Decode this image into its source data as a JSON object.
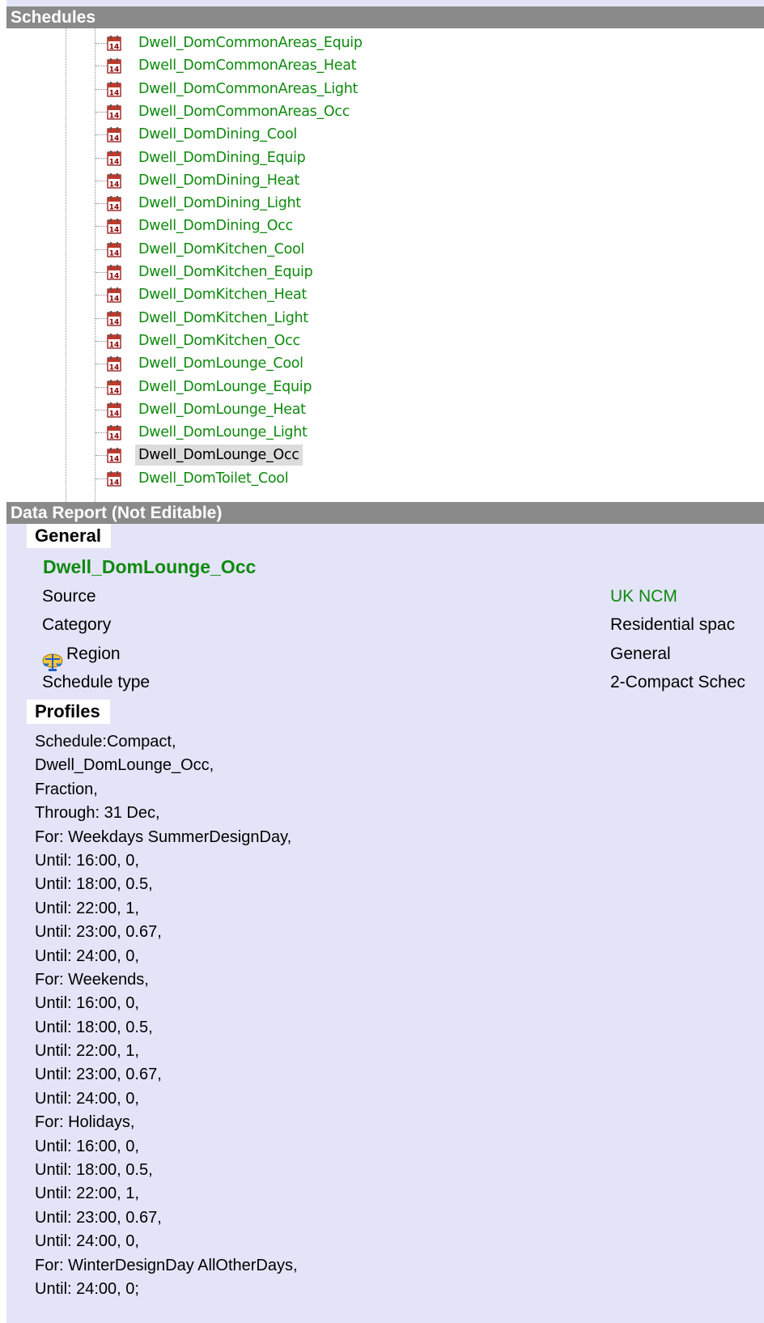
{
  "schedules_panel": {
    "title": "Schedules",
    "items": [
      {
        "label": "Dwell_DomCommonAreas_Equip",
        "selected": false
      },
      {
        "label": "Dwell_DomCommonAreas_Heat",
        "selected": false
      },
      {
        "label": "Dwell_DomCommonAreas_Light",
        "selected": false
      },
      {
        "label": "Dwell_DomCommonAreas_Occ",
        "selected": false
      },
      {
        "label": "Dwell_DomDining_Cool",
        "selected": false
      },
      {
        "label": "Dwell_DomDining_Equip",
        "selected": false
      },
      {
        "label": "Dwell_DomDining_Heat",
        "selected": false
      },
      {
        "label": "Dwell_DomDining_Light",
        "selected": false
      },
      {
        "label": "Dwell_DomDining_Occ",
        "selected": false
      },
      {
        "label": "Dwell_DomKitchen_Cool",
        "selected": false
      },
      {
        "label": "Dwell_DomKitchen_Equip",
        "selected": false
      },
      {
        "label": "Dwell_DomKitchen_Heat",
        "selected": false
      },
      {
        "label": "Dwell_DomKitchen_Light",
        "selected": false
      },
      {
        "label": "Dwell_DomKitchen_Occ",
        "selected": false
      },
      {
        "label": "Dwell_DomLounge_Cool",
        "selected": false
      },
      {
        "label": "Dwell_DomLounge_Equip",
        "selected": false
      },
      {
        "label": "Dwell_DomLounge_Heat",
        "selected": false
      },
      {
        "label": "Dwell_DomLounge_Light",
        "selected": false
      },
      {
        "label": "Dwell_DomLounge_Occ",
        "selected": true
      },
      {
        "label": "Dwell_DomToilet_Cool",
        "selected": false
      }
    ],
    "item_icon": "calendar-14-icon"
  },
  "report_panel": {
    "title": "Data Report (Not Editable)",
    "general": {
      "heading": "General",
      "name": "Dwell_DomLounge_Occ",
      "source_label": "Source",
      "source_value": "UK NCM",
      "category_label": "Category",
      "category_value": "Residential spac",
      "region_label": "Region",
      "region_value": "General",
      "region_icon": "region-scale-icon",
      "type_label": "Schedule type",
      "type_value": "2-Compact Schec"
    },
    "profiles": {
      "heading": "Profiles",
      "lines": [
        "Schedule:Compact,",
        "Dwell_DomLounge_Occ,",
        "Fraction,",
        "Through: 31 Dec,",
        "For: Weekdays SummerDesignDay,",
        "Until: 16:00, 0,",
        "Until: 18:00, 0.5,",
        "Until: 22:00, 1,",
        "Until: 23:00, 0.67,",
        "Until: 24:00, 0,",
        "For: Weekends,",
        "Until: 16:00, 0,",
        "Until: 18:00, 0.5,",
        "Until: 22:00, 1,",
        "Until: 23:00, 0.67,",
        "Until: 24:00, 0,",
        "For: Holidays,",
        "Until: 16:00, 0,",
        "Until: 18:00, 0.5,",
        "Until: 22:00, 1,",
        "Until: 23:00, 0.67,",
        "Until: 24:00, 0,",
        "For: WinterDesignDay AllOtherDays,",
        "Until: 24:00, 0;"
      ]
    }
  },
  "colors": {
    "header_bg": "#8a8a8a",
    "report_bg": "#e4e4f8",
    "item_text": "#0e8a0e",
    "selection_bg": "#dcdcdc"
  }
}
